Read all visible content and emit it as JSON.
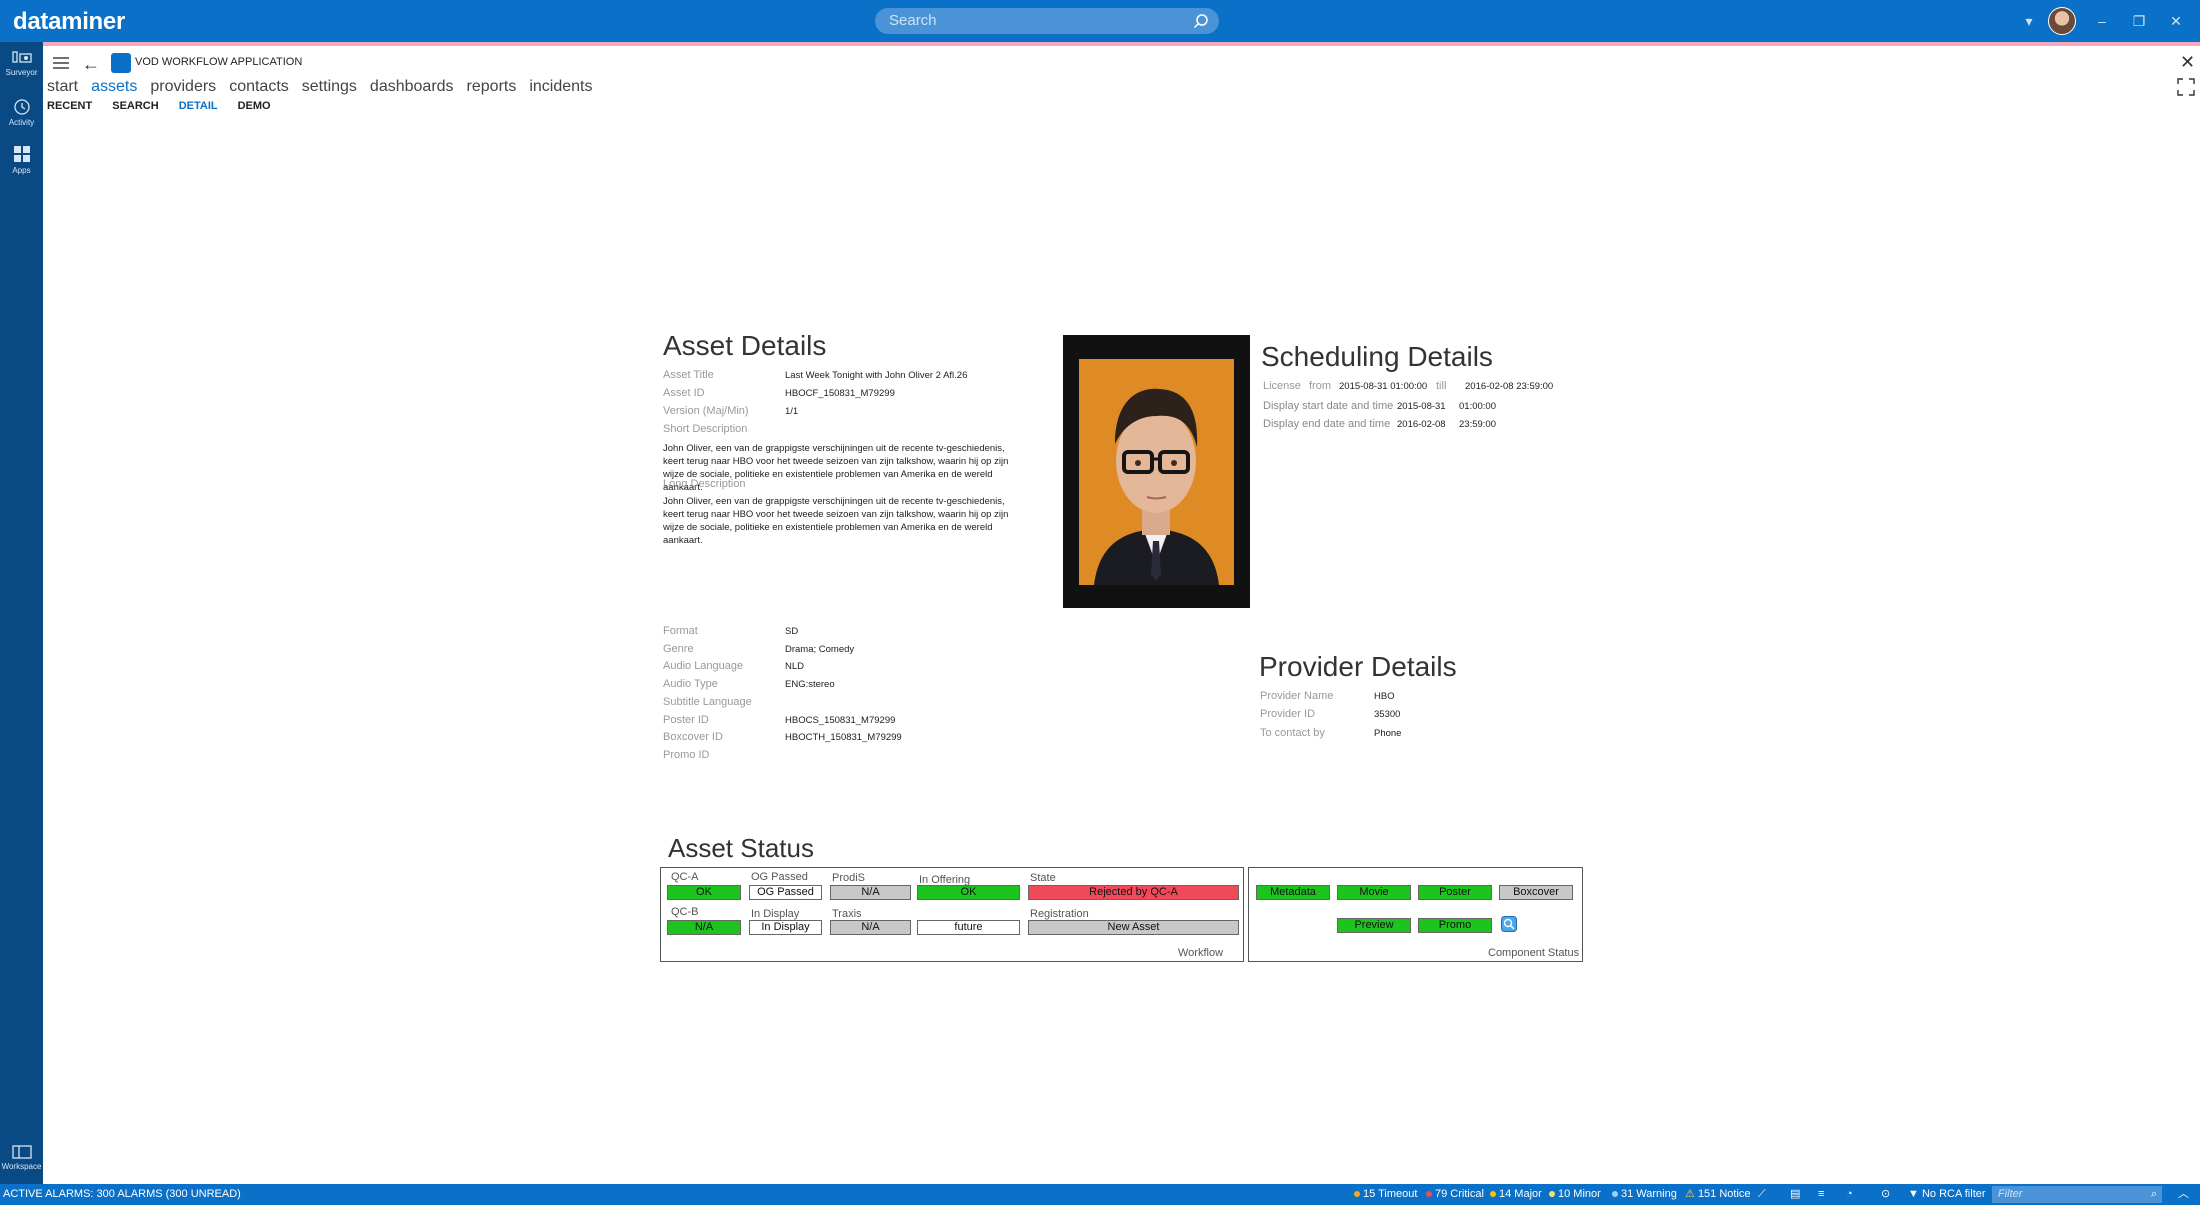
{
  "titlebar": {
    "logo": "dataminer",
    "search_placeholder": "Search"
  },
  "leftbar": {
    "items": [
      {
        "label": "Surveyor",
        "icon": "surveyor-icon"
      },
      {
        "label": "Activity",
        "icon": "activity-icon"
      },
      {
        "label": "Apps",
        "icon": "apps-icon"
      }
    ],
    "workspace": "Workspace"
  },
  "app": {
    "title": "VOD WORKFLOW APPLICATION",
    "nav": [
      "start",
      "assets",
      "providers",
      "contacts",
      "settings",
      "dashboards",
      "reports",
      "incidents"
    ],
    "active_nav": "assets",
    "subnav": [
      "RECENT",
      "SEARCH",
      "DETAIL",
      "DEMO"
    ],
    "active_subnav": "DETAIL"
  },
  "asset_details": {
    "heading": "Asset Details",
    "asset_title_label": "Asset Title",
    "asset_title": "Last Week Tonight with John Oliver 2 Afl.26",
    "asset_id_label": "Asset ID",
    "asset_id": "HBOCF_150831_M79299",
    "version_label": "Version (Maj/Min)",
    "version": "1/1",
    "short_desc_label": "Short Description",
    "short_desc": "John Oliver, een van de grappigste verschijningen uit de recente tv-geschiedenis, keert terug naar HBO voor het tweede seizoen van zijn talkshow, waarin hij op zijn wijze de sociale, politieke en existentiele problemen van Amerika en de wereld aankaart.",
    "long_desc_label": "Long Description",
    "long_desc": "John Oliver, een van de grappigste verschijningen uit de recente tv-geschiedenis, keert terug naar HBO voor het tweede seizoen van zijn talkshow, waarin hij op zijn wijze de sociale, politieke en existentiele problemen van Amerika en de wereld aankaart.",
    "format_label": "Format",
    "format": "SD",
    "genre_label": "Genre",
    "genre": "Drama; Comedy",
    "audio_lang_label": "Audio Language",
    "audio_lang": "NLD",
    "audio_type_label": "Audio Type",
    "audio_type": "ENG:stereo",
    "subtitle_lang_label": "Subtitle Language",
    "subtitle_lang": "",
    "poster_id_label": "Poster ID",
    "poster_id": "HBOCS_150831_M79299",
    "boxcover_id_label": "Boxcover ID",
    "boxcover_id": "HBOCTH_150831_M79299",
    "promo_id_label": "Promo ID",
    "promo_id": ""
  },
  "scheduling": {
    "heading": "Scheduling Details",
    "license_label": "License",
    "from_label": "from",
    "license_from": "2015-08-31 01:00:00",
    "till_label": "till",
    "license_till": "2016-02-08 23:59:00",
    "display_start_label": "Display start date and time",
    "display_start_date": "2015-08-31",
    "display_start_time": "01:00:00",
    "display_end_label": "Display end date and time",
    "display_end_date": "2016-02-08",
    "display_end_time": "23:59:00"
  },
  "provider": {
    "heading": "Provider Details",
    "name_label": "Provider Name",
    "name": "HBO",
    "id_label": "Provider ID",
    "id": "35300",
    "contact_label": "To contact by",
    "contact": "Phone"
  },
  "asset_status": {
    "heading": "Asset Status",
    "workflow_caption": "Workflow",
    "component_caption": "Component Status",
    "workflow": {
      "qca_label": "QC-A",
      "qca": "OK",
      "og_label": "OG Passed",
      "og": "OG Passed",
      "prodis_label": "ProdiS",
      "prodis": "N/A",
      "offering_label": "In Offering",
      "offering": "OK",
      "state_label": "State",
      "state": "Rejected by QC-A",
      "qcb_label": "QC-B",
      "qcb": "N/A",
      "display_label": "In Display",
      "display": "In Display",
      "traxis_label": "Traxis",
      "traxis": "N/A",
      "future": "future",
      "registration_label": "Registration",
      "registration": "New Asset"
    },
    "components": {
      "metadata": "Metadata",
      "movie": "Movie",
      "poster": "Poster",
      "boxcover": "Boxcover",
      "preview": "Preview",
      "promo": "Promo"
    }
  },
  "statusbar": {
    "alarms": "ACTIVE ALARMS: 300 ALARMS (300 UNREAD)",
    "timeout": "15 Timeout",
    "critical": "79 Critical",
    "major": "14 Major",
    "minor": "10 Minor",
    "warning": "31 Warning",
    "notice": "151 Notice",
    "rca": "No RCA filter",
    "filter_placeholder": "Filter",
    "colors": {
      "timeout": "#f5a623",
      "critical": "#f04a5a",
      "major": "#f7c600",
      "minor": "#f7e36b",
      "warning": "#9ad0ff",
      "notice": "#ffd24a"
    }
  }
}
